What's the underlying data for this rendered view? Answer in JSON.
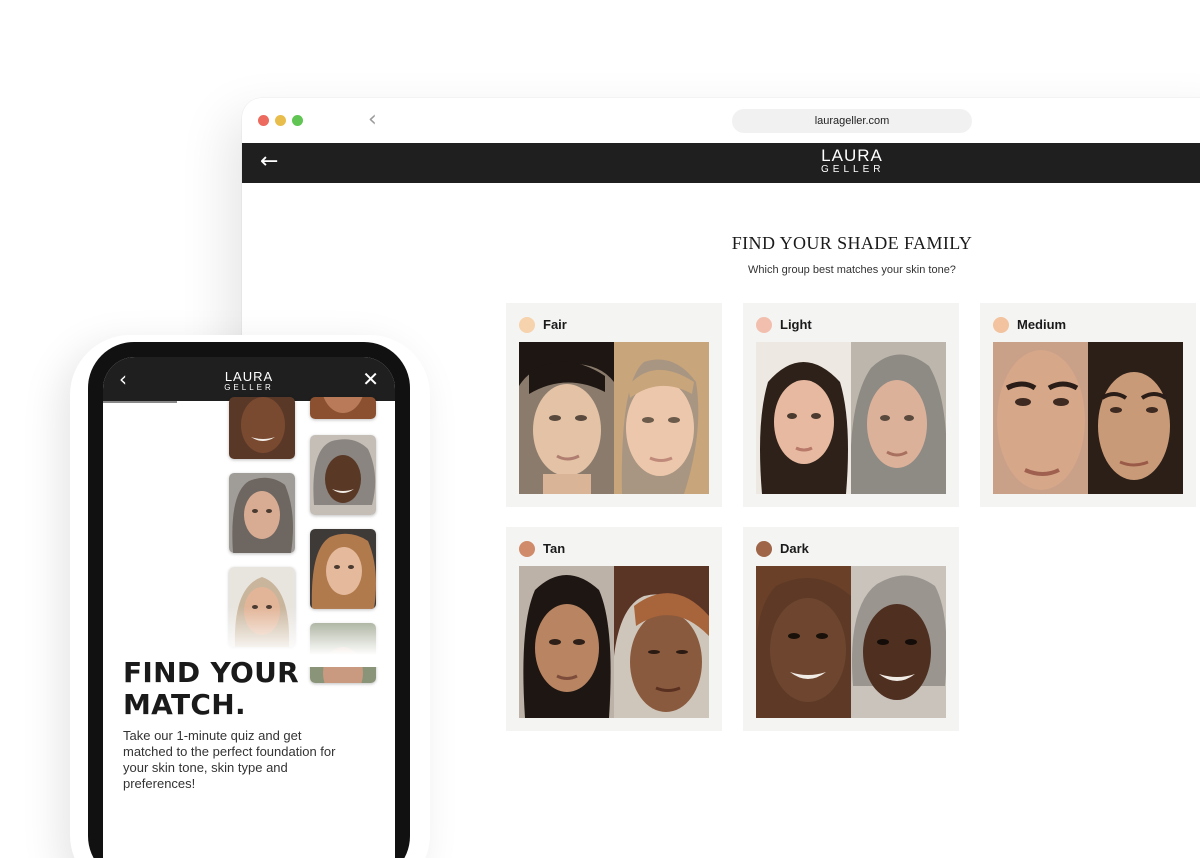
{
  "browser": {
    "url": "laurageller.com",
    "back_icon": "chevron-left-icon"
  },
  "site": {
    "logo_line1": "LAURA",
    "logo_line2": "GELLER",
    "back_icon": "arrow-left-icon"
  },
  "quiz": {
    "title": "FIND YOUR SHADE FAMILY",
    "subtitle": "Which group best matches your skin tone?",
    "options": [
      {
        "label": "Fair",
        "swatch": "#f6d2ad"
      },
      {
        "label": "Light",
        "swatch": "#f2bfae"
      },
      {
        "label": "Medium",
        "swatch": "#f2c39e"
      },
      {
        "label": "Tan",
        "swatch": "#cf8b6a"
      },
      {
        "label": "Dark",
        "swatch": "#9f6548"
      }
    ]
  },
  "phone": {
    "logo_line1": "LAURA",
    "logo_line2": "GELLER",
    "title": "FIND YOUR MATCH.",
    "body": "Take our 1-minute quiz and get matched to the perfect foundation for your skin tone, skin type and preferences!"
  },
  "colors": {
    "header_bg": "#1f1f1f",
    "card_bg": "#f4f4f3"
  }
}
